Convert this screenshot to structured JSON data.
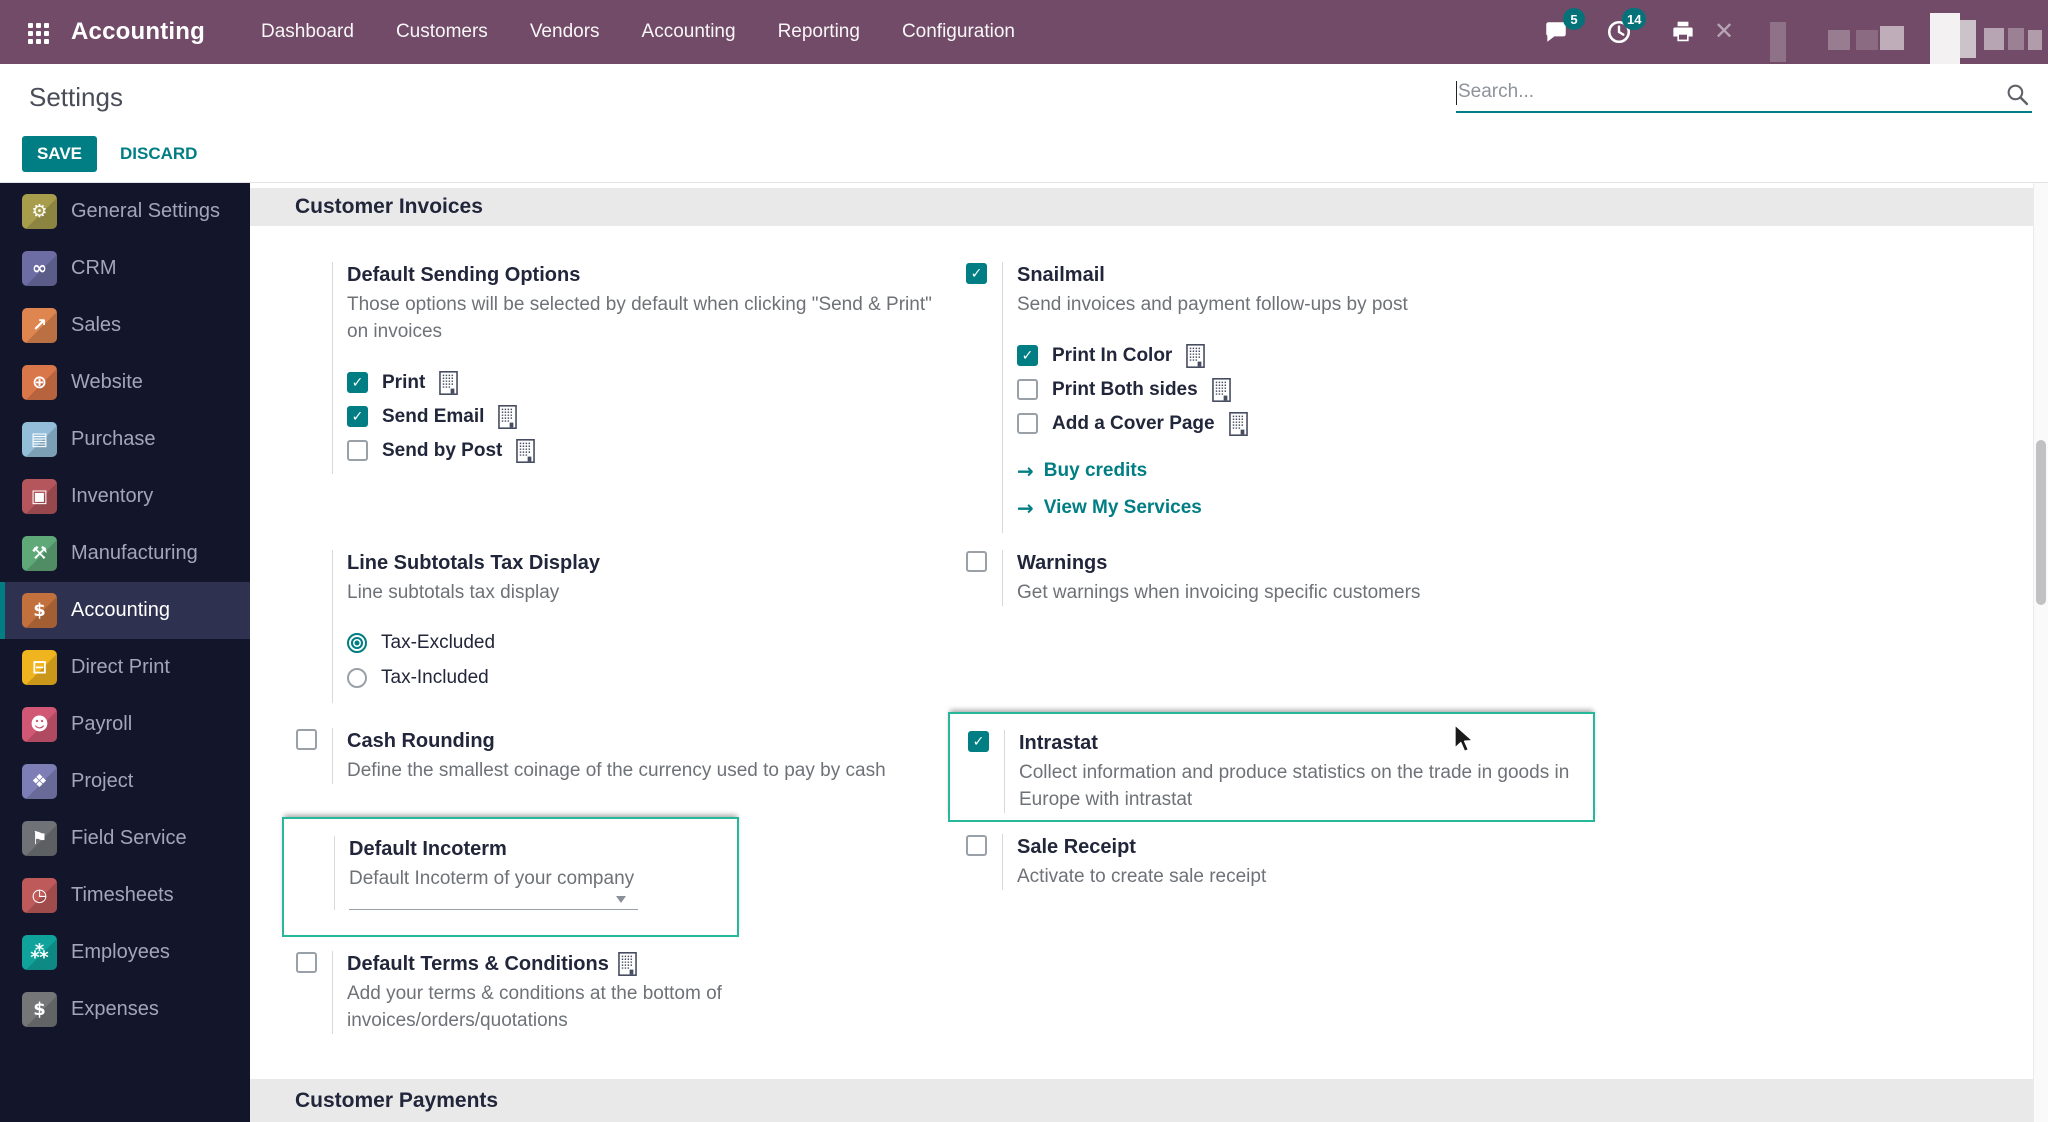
{
  "colors": {
    "accent": "#017e84",
    "nav_bg": "#714b67",
    "sidebar_bg": "#13152a",
    "sidebar_active": "#2e3150",
    "highlight": "#27b79b",
    "badge_bg": "#05727a",
    "band_bg": "#e9e9e9",
    "title": "#21263a",
    "desc": "#6e7277",
    "sidebar_text": "#a3a6b8",
    "link": "#017e84"
  },
  "nav": {
    "brand": "Accounting",
    "menu": [
      "Dashboard",
      "Customers",
      "Vendors",
      "Accounting",
      "Reporting",
      "Configuration"
    ],
    "messages_badge": "5",
    "activities_badge": "14"
  },
  "header": {
    "title": "Settings",
    "search_placeholder": "Search...",
    "save_label": "SAVE",
    "discard_label": "DISCARD"
  },
  "sidebar": {
    "items": [
      {
        "label": "General Settings",
        "glyph": "⚙",
        "color": "#a79d4d",
        "active": false
      },
      {
        "label": "CRM",
        "glyph": "∞",
        "color": "#6d6da3",
        "active": false
      },
      {
        "label": "Sales",
        "glyph": "↗",
        "color": "#de8550",
        "active": false
      },
      {
        "label": "Website",
        "glyph": "⊕",
        "color": "#d9764a",
        "active": false
      },
      {
        "label": "Purchase",
        "glyph": "▤",
        "color": "#93bdd8",
        "active": false
      },
      {
        "label": "Inventory",
        "glyph": "▣",
        "color": "#b4565c",
        "active": false
      },
      {
        "label": "Manufacturing",
        "glyph": "⚒",
        "color": "#5fa878",
        "active": false
      },
      {
        "label": "Accounting",
        "glyph": "$",
        "color": "#c2703e",
        "active": true
      },
      {
        "label": "Direct Print",
        "glyph": "⊟",
        "color": "#f0b41f",
        "active": false
      },
      {
        "label": "Payroll",
        "glyph": "☻",
        "color": "#d05874",
        "active": false
      },
      {
        "label": "Project",
        "glyph": "❖",
        "color": "#7d7eb5",
        "active": false
      },
      {
        "label": "Field Service",
        "glyph": "⚑",
        "color": "#6f7276",
        "active": false
      },
      {
        "label": "Timesheets",
        "glyph": "◷",
        "color": "#bf5a5a",
        "active": false
      },
      {
        "label": "Employees",
        "glyph": "⁂",
        "color": "#10a39c",
        "active": false
      },
      {
        "label": "Expenses",
        "glyph": "$",
        "color": "#747678",
        "active": false
      }
    ]
  },
  "sections": {
    "invoices": "Customer Invoices",
    "payments": "Customer Payments"
  },
  "settings": {
    "default_sending": {
      "title": "Default Sending Options",
      "desc": "Those options will be selected by default when clicking \"Send & Print\" on invoices",
      "options": [
        {
          "label": "Print",
          "checked": true
        },
        {
          "label": "Send Email",
          "checked": true
        },
        {
          "label": "Send by Post",
          "checked": false
        }
      ]
    },
    "snailmail": {
      "checked": true,
      "title": "Snailmail",
      "desc": "Send invoices and payment follow-ups by post",
      "options": [
        {
          "label": "Print In Color",
          "checked": true
        },
        {
          "label": "Print Both sides",
          "checked": false
        },
        {
          "label": "Add a Cover Page",
          "checked": false
        }
      ],
      "links": [
        {
          "label": "Buy credits"
        },
        {
          "label": "View My Services"
        }
      ]
    },
    "line_subtotals": {
      "title": "Line Subtotals Tax Display",
      "desc": "Line subtotals tax display",
      "radios": [
        {
          "label": "Tax-Excluded",
          "selected": true
        },
        {
          "label": "Tax-Included",
          "selected": false
        }
      ]
    },
    "warnings": {
      "checked": false,
      "title": "Warnings",
      "desc": "Get warnings when invoicing specific customers"
    },
    "cash_rounding": {
      "checked": false,
      "title": "Cash Rounding",
      "desc": "Define the smallest coinage of the currency used to pay by cash"
    },
    "intrastat": {
      "checked": true,
      "highlighted": true,
      "title": "Intrastat",
      "desc": "Collect information and produce statistics on the trade in goods in Europe with intrastat"
    },
    "default_incoterm": {
      "highlighted": true,
      "title": "Default Incoterm",
      "desc": "Default Incoterm of your company",
      "value": ""
    },
    "sale_receipt": {
      "checked": false,
      "title": "Sale Receipt",
      "desc": "Activate to create sale receipt"
    },
    "default_terms": {
      "checked": false,
      "title": "Default Terms & Conditions",
      "desc": "Add your terms & conditions at the bottom of invoices/orders/quotations"
    }
  },
  "icons": {
    "check": "✓",
    "link_arrow": "→",
    "tools": "✕"
  }
}
